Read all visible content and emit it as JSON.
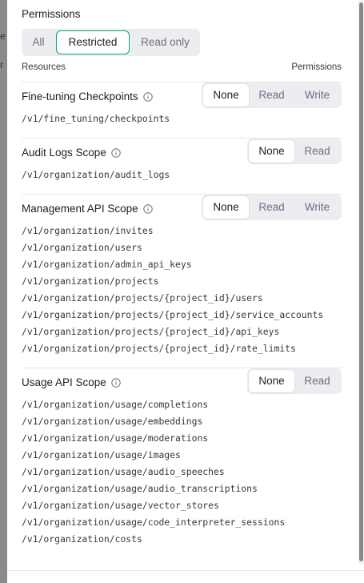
{
  "backdrop": {
    "fragment_top": "e",
    "fragment_bottom": "r"
  },
  "permissions": {
    "title": "Permissions",
    "modes": [
      "All",
      "Restricted",
      "Read only"
    ],
    "active_mode": "Restricted",
    "columns": {
      "resources": "Resources",
      "permissions": "Permissions"
    }
  },
  "sections": [
    {
      "title": "Fine-tuning Checkpoints",
      "options": [
        "None",
        "Read",
        "Write"
      ],
      "selected": "None",
      "paths": [
        "/v1/fine_tuning/checkpoints"
      ]
    },
    {
      "title": "Audit Logs Scope",
      "options": [
        "None",
        "Read"
      ],
      "selected": "None",
      "paths": [
        "/v1/organization/audit_logs"
      ]
    },
    {
      "title": "Management API Scope",
      "options": [
        "None",
        "Read",
        "Write"
      ],
      "selected": "None",
      "paths": [
        "/v1/organization/invites",
        "/v1/organization/users",
        "/v1/organization/admin_api_keys",
        "/v1/organization/projects",
        "/v1/organization/projects/{project_id}/users",
        "/v1/organization/projects/{project_id}/service_accounts",
        "/v1/organization/projects/{project_id}/api_keys",
        "/v1/organization/projects/{project_id}/rate_limits"
      ]
    },
    {
      "title": "Usage API Scope",
      "options": [
        "None",
        "Read"
      ],
      "selected": "None",
      "paths": [
        "/v1/organization/usage/completions",
        "/v1/organization/usage/embeddings",
        "/v1/organization/usage/moderations",
        "/v1/organization/usage/images",
        "/v1/organization/usage/audio_speeches",
        "/v1/organization/usage/audio_transcriptions",
        "/v1/organization/usage/vector_stores",
        "/v1/organization/usage/code_interpreter_sessions",
        "/v1/organization/costs"
      ]
    }
  ],
  "colors": {
    "accent": "#10a37f",
    "segment_bg": "#ececf1"
  }
}
